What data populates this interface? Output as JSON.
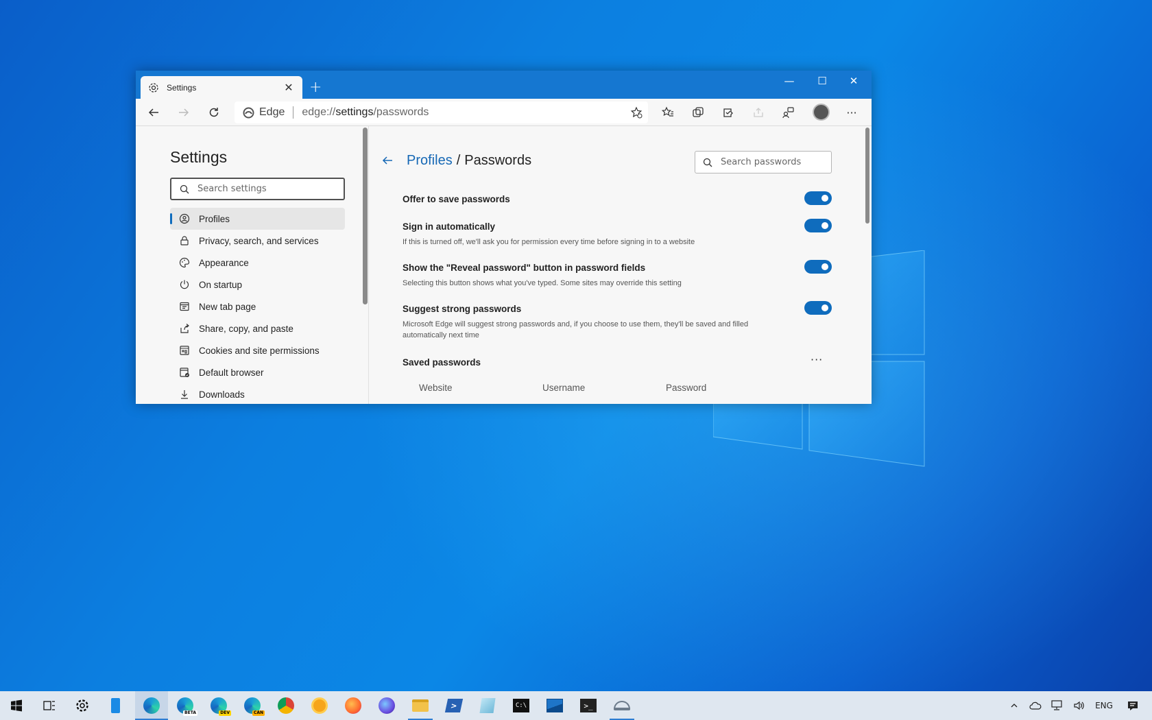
{
  "browser": {
    "tab": {
      "title": "Settings",
      "close_glyph": "✕"
    },
    "new_tab_glyph": "+",
    "window_controls": {
      "minimize": "—",
      "maximize": "☐",
      "close": "✕"
    },
    "address": {
      "site_label": "Edge",
      "url_prefix": "edge://",
      "url_path": "settings",
      "url_suffix": "/passwords"
    },
    "more_glyph": "···"
  },
  "sidebar": {
    "title": "Settings",
    "search_placeholder": "Search settings",
    "items": [
      {
        "label": "Profiles",
        "icon": "profile-icon",
        "active": true
      },
      {
        "label": "Privacy, search, and services",
        "icon": "lock-icon"
      },
      {
        "label": "Appearance",
        "icon": "palette-icon"
      },
      {
        "label": "On startup",
        "icon": "power-icon"
      },
      {
        "label": "New tab page",
        "icon": "newtab-icon"
      },
      {
        "label": "Share, copy, and paste",
        "icon": "share-icon"
      },
      {
        "label": "Cookies and site permissions",
        "icon": "cookies-icon"
      },
      {
        "label": "Default browser",
        "icon": "browser-icon"
      },
      {
        "label": "Downloads",
        "icon": "download-icon"
      }
    ]
  },
  "main": {
    "breadcrumb": {
      "parent": "Profiles",
      "separator": "/",
      "current": "Passwords"
    },
    "search_placeholder": "Search passwords",
    "settings": [
      {
        "title": "Offer to save passwords",
        "description": "",
        "enabled": true
      },
      {
        "title": "Sign in automatically",
        "description": "If this is turned off, we'll ask you for permission every time before signing in to a website",
        "enabled": true
      },
      {
        "title": "Show the \"Reveal password\" button in password fields",
        "description": "Selecting this button shows what you've typed. Some sites may override this setting",
        "enabled": true
      },
      {
        "title": "Suggest strong passwords",
        "description": "Microsoft Edge will suggest strong passwords and, if you choose to use them, they'll be saved and filled automatically next time",
        "enabled": true
      }
    ],
    "saved_passwords": {
      "title": "Saved passwords",
      "more_glyph": "···",
      "columns": [
        "Website",
        "Username",
        "Password"
      ]
    }
  },
  "taskbar": {
    "apps": [
      {
        "name": "Edge"
      },
      {
        "name": "Edge Beta",
        "badge": "BETA"
      },
      {
        "name": "Edge Dev",
        "badge": "DEV"
      },
      {
        "name": "Edge Canary",
        "badge": "CAN"
      },
      {
        "name": "Chrome"
      },
      {
        "name": "Chrome Canary"
      },
      {
        "name": "Firefox"
      },
      {
        "name": "Firefox Nightly"
      },
      {
        "name": "File Explorer"
      },
      {
        "name": "PowerShell"
      },
      {
        "name": "Notepad"
      },
      {
        "name": "Command Prompt"
      },
      {
        "name": "Photos"
      },
      {
        "name": "Terminal"
      },
      {
        "name": "Remote Desktop"
      }
    ],
    "tray": {
      "language": "ENG"
    }
  },
  "colors": {
    "accent": "#0f6cbd",
    "titlebar": "#1577d1",
    "link": "#1668b5"
  }
}
